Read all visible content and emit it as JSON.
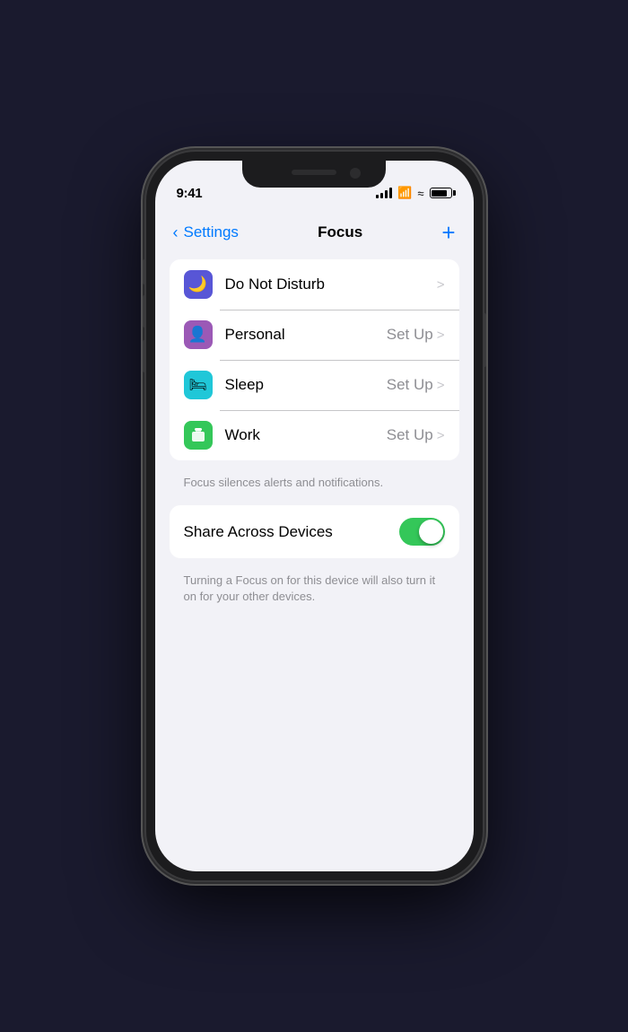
{
  "status_bar": {
    "time": "9:41"
  },
  "header": {
    "back_label": "Settings",
    "title": "Focus",
    "add_label": "+"
  },
  "focus_items": [
    {
      "id": "do-not-disturb",
      "label": "Do Not Disturb",
      "icon": "🌙",
      "icon_bg": "#5856d6",
      "action": "",
      "has_setup": false
    },
    {
      "id": "personal",
      "label": "Personal",
      "icon": "👤",
      "icon_bg": "#9b59b6",
      "action": "Set Up",
      "has_setup": true
    },
    {
      "id": "sleep",
      "label": "Sleep",
      "icon": "🛏",
      "icon_bg": "#20c7d8",
      "action": "Set Up",
      "has_setup": true
    },
    {
      "id": "work",
      "label": "Work",
      "icon": "📱",
      "icon_bg": "#34c759",
      "action": "Set Up",
      "has_setup": true
    }
  ],
  "focus_caption": "Focus silences alerts and notifications.",
  "share_across_devices": {
    "label": "Share Across Devices",
    "enabled": true,
    "caption": "Turning a Focus on for this device will also turn it on for your other devices."
  }
}
